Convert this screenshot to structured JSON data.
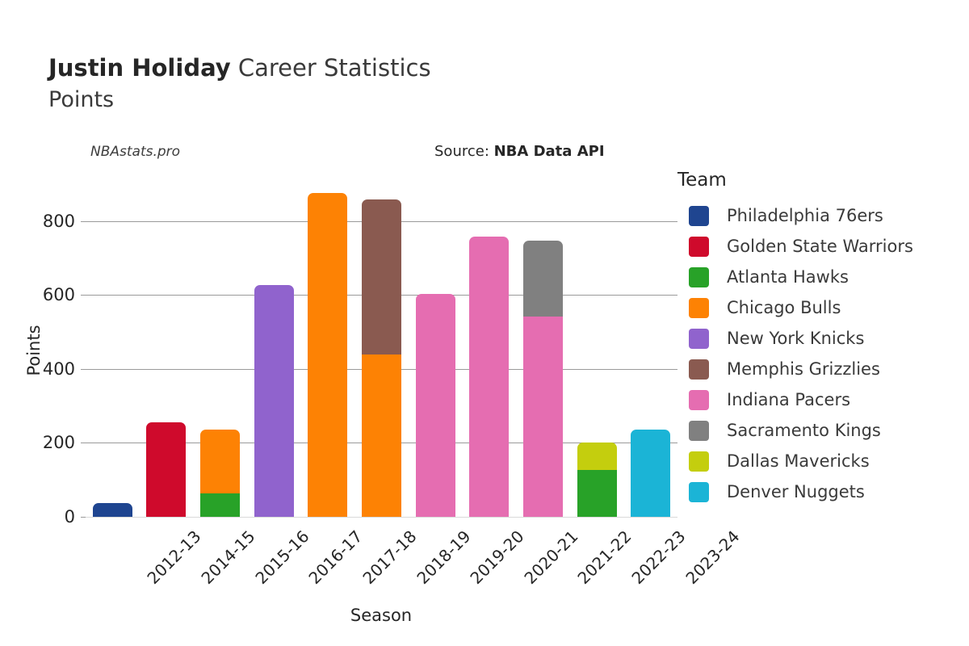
{
  "header": {
    "player_name": "Justin Holiday",
    "title_suffix": " Career Statistics",
    "stat_name": "Points",
    "watermark": "NBAstats.pro",
    "source_prefix": "Source: ",
    "source_value": "NBA Data API"
  },
  "legend": {
    "title": "Team",
    "items": [
      {
        "label": "Philadelphia 76ers",
        "color": "#1f4590"
      },
      {
        "label": "Golden State Warriors",
        "color": "#cf0a2c"
      },
      {
        "label": "Atlanta Hawks",
        "color": "#28a228"
      },
      {
        "label": "Chicago Bulls",
        "color": "#fd8204"
      },
      {
        "label": "New York Knicks",
        "color": "#9063cd"
      },
      {
        "label": "Memphis Grizzlies",
        "color": "#8a5a50"
      },
      {
        "label": "Indiana Pacers",
        "color": "#e56db1"
      },
      {
        "label": "Sacramento Kings",
        "color": "#808080"
      },
      {
        "label": "Dallas Mavericks",
        "color": "#c4ce0e"
      },
      {
        "label": "Denver Nuggets",
        "color": "#1bb4d6"
      }
    ]
  },
  "chart_data": {
    "type": "bar",
    "stacked": true,
    "title": "Justin Holiday Career Statistics",
    "subtitle": "Points",
    "xlabel": "Season",
    "ylabel": "Points",
    "ylim": [
      0,
      900
    ],
    "yticks": [
      0,
      200,
      400,
      600,
      800
    ],
    "grid": true,
    "legend_position": "right",
    "categories": [
      "2012-13",
      "2014-15",
      "2015-16",
      "2016-17",
      "2017-18",
      "2018-19",
      "2019-20",
      "2020-21",
      "2021-22",
      "2022-23",
      "2023-24"
    ],
    "series": [
      {
        "name": "Philadelphia 76ers",
        "color": "#1f4590",
        "values": [
          37,
          0,
          0,
          0,
          0,
          0,
          0,
          0,
          0,
          0,
          0
        ]
      },
      {
        "name": "Golden State Warriors",
        "color": "#cf0a2c",
        "values": [
          0,
          256,
          0,
          0,
          0,
          0,
          0,
          0,
          0,
          0,
          0
        ]
      },
      {
        "name": "Atlanta Hawks",
        "color": "#28a228",
        "values": [
          0,
          0,
          63,
          0,
          0,
          0,
          0,
          0,
          0,
          127,
          0
        ]
      },
      {
        "name": "Chicago Bulls",
        "color": "#fd8204",
        "values": [
          0,
          0,
          174,
          0,
          877,
          440,
          0,
          0,
          0,
          0,
          0
        ]
      },
      {
        "name": "New York Knicks",
        "color": "#9063cd",
        "values": [
          0,
          0,
          0,
          628,
          0,
          0,
          0,
          0,
          0,
          0,
          0
        ]
      },
      {
        "name": "Memphis Grizzlies",
        "color": "#8a5a50",
        "values": [
          0,
          0,
          0,
          0,
          0,
          418,
          0,
          0,
          0,
          0,
          0
        ]
      },
      {
        "name": "Indiana Pacers",
        "color": "#e56db1",
        "values": [
          0,
          0,
          0,
          0,
          0,
          0,
          602,
          757,
          542,
          0,
          0
        ]
      },
      {
        "name": "Sacramento Kings",
        "color": "#808080",
        "values": [
          0,
          0,
          0,
          0,
          0,
          0,
          0,
          0,
          205,
          0,
          0
        ]
      },
      {
        "name": "Dallas Mavericks",
        "color": "#c4ce0e",
        "values": [
          0,
          0,
          0,
          0,
          0,
          0,
          0,
          0,
          0,
          74,
          0
        ]
      },
      {
        "name": "Denver Nuggets",
        "color": "#1bb4d6",
        "values": [
          0,
          0,
          0,
          0,
          0,
          0,
          0,
          0,
          0,
          0,
          235
        ]
      }
    ],
    "totals": [
      37,
      256,
      237,
      628,
      877,
      858,
      602,
      757,
      747,
      201,
      235
    ]
  }
}
